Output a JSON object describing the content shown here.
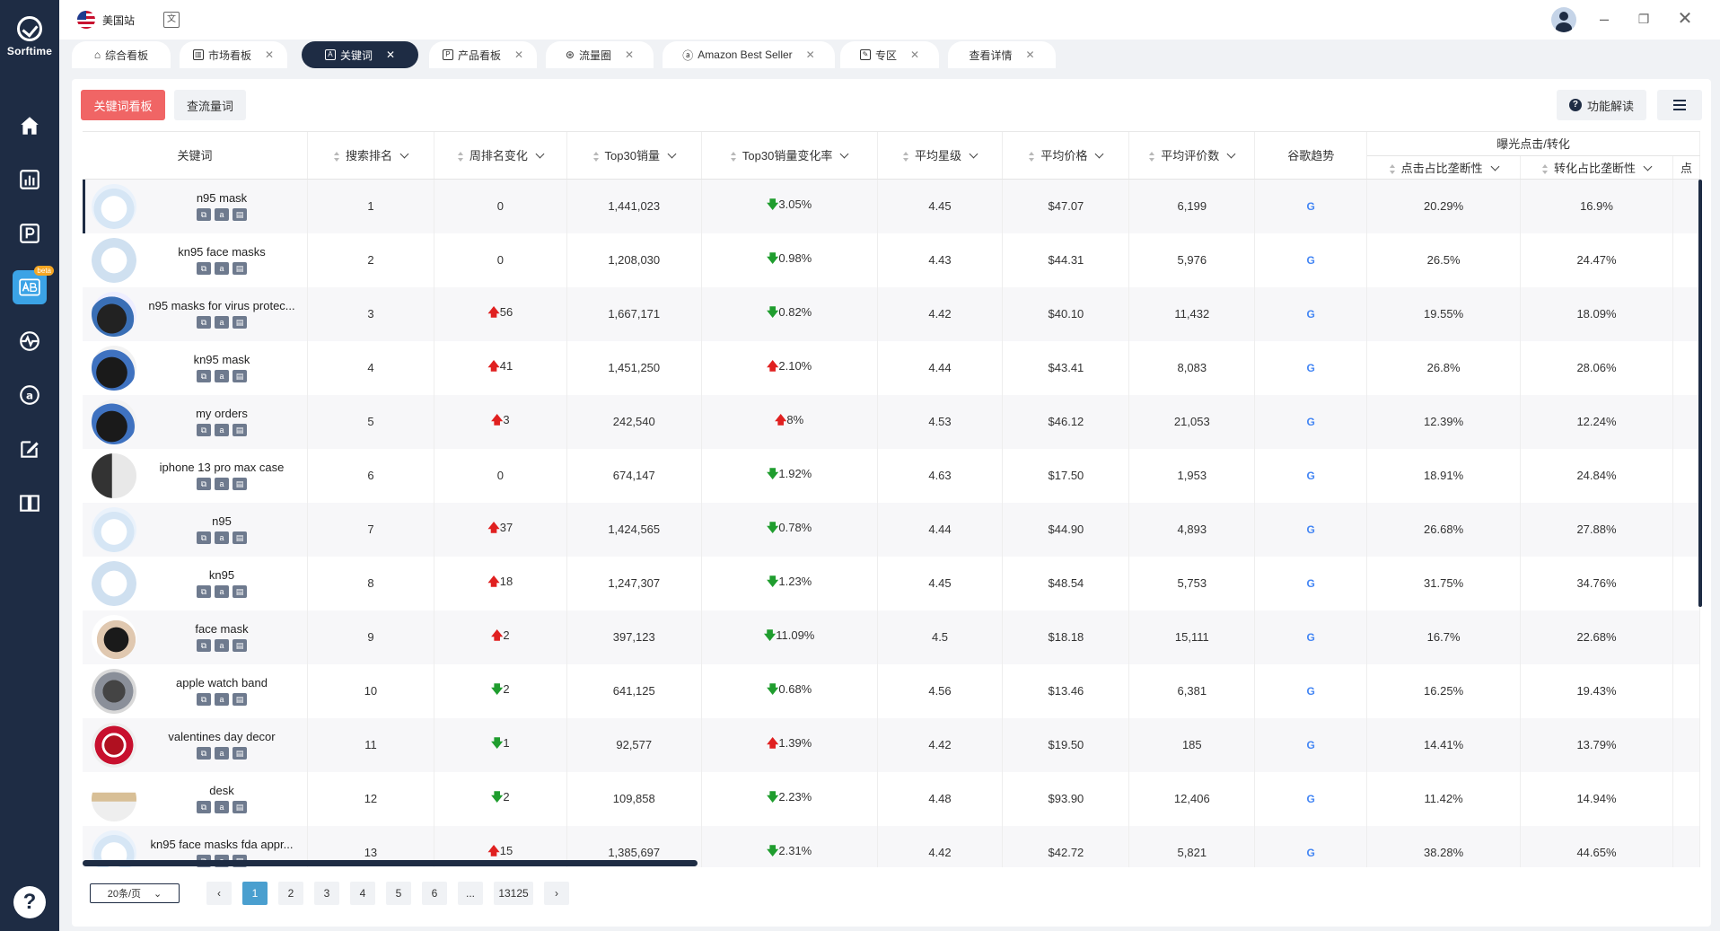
{
  "brand": {
    "name": "Sorftime",
    "beta": "beta"
  },
  "topbar": {
    "site": "美国站",
    "translate_icon": "文"
  },
  "tabs": [
    {
      "label": "综合看板",
      "icon": "home-icon",
      "closable": false
    },
    {
      "label": "市场看板",
      "icon": "chart-icon",
      "closable": true
    },
    {
      "label": "关键词",
      "icon": "keyword-icon",
      "closable": true,
      "active": true
    },
    {
      "label": "产品看板",
      "icon": "product-icon",
      "closable": true
    },
    {
      "label": "流量圈",
      "icon": "traffic-icon",
      "closable": true
    },
    {
      "label": "Amazon Best Seller",
      "icon": "amazon-icon",
      "closable": true
    },
    {
      "label": "专区",
      "icon": "edit-icon",
      "closable": true
    },
    {
      "label": "查看详情",
      "icon": "",
      "closable": true
    }
  ],
  "toolbar": {
    "btn_primary": "关键词看板",
    "btn_secondary": "查流量词",
    "btn_func": "功能解读"
  },
  "table": {
    "group_header": "曝光点击/转化",
    "columns": [
      "关键词",
      "搜索排名",
      "周排名变化",
      "Top30销量",
      "Top30销量变化率",
      "平均星级",
      "平均价格",
      "平均评价数",
      "谷歌趋势",
      "点击占比垄断性",
      "转化占比垄断性",
      "点"
    ],
    "rows": [
      {
        "kw": "n95 mask",
        "rank": "1",
        "chg": "0",
        "chg_dir": "",
        "sales": "1,441,023",
        "rate": "3.05%",
        "rate_dir": "down",
        "star": "4.45",
        "price": "$47.07",
        "reviews": "6,199",
        "click": "20.29%",
        "conv": "16.9%"
      },
      {
        "kw": "kn95 face masks",
        "rank": "2",
        "chg": "0",
        "chg_dir": "",
        "sales": "1,208,030",
        "rate": "0.98%",
        "rate_dir": "down",
        "star": "4.43",
        "price": "$44.31",
        "reviews": "5,976",
        "click": "26.5%",
        "conv": "24.47%"
      },
      {
        "kw": "n95 masks for virus protec...",
        "rank": "3",
        "chg": "56",
        "chg_dir": "up",
        "sales": "1,667,171",
        "rate": "0.82%",
        "rate_dir": "down",
        "star": "4.42",
        "price": "$40.10",
        "reviews": "11,432",
        "click": "19.55%",
        "conv": "18.09%"
      },
      {
        "kw": "kn95 mask",
        "rank": "4",
        "chg": "41",
        "chg_dir": "up",
        "sales": "1,451,250",
        "rate": "2.10%",
        "rate_dir": "up",
        "star": "4.44",
        "price": "$43.41",
        "reviews": "8,083",
        "click": "26.8%",
        "conv": "28.06%"
      },
      {
        "kw": "my orders",
        "rank": "5",
        "chg": "3",
        "chg_dir": "up",
        "sales": "242,540",
        "rate": "8%",
        "rate_dir": "up",
        "star": "4.53",
        "price": "$46.12",
        "reviews": "21,053",
        "click": "12.39%",
        "conv": "12.24%"
      },
      {
        "kw": "iphone 13 pro max case",
        "rank": "6",
        "chg": "0",
        "chg_dir": "",
        "sales": "674,147",
        "rate": "1.92%",
        "rate_dir": "down",
        "star": "4.63",
        "price": "$17.50",
        "reviews": "1,953",
        "click": "18.91%",
        "conv": "24.84%"
      },
      {
        "kw": "n95",
        "rank": "7",
        "chg": "37",
        "chg_dir": "up",
        "sales": "1,424,565",
        "rate": "0.78%",
        "rate_dir": "down",
        "star": "4.44",
        "price": "$44.90",
        "reviews": "4,893",
        "click": "26.68%",
        "conv": "27.88%"
      },
      {
        "kw": "kn95",
        "rank": "8",
        "chg": "18",
        "chg_dir": "up",
        "sales": "1,247,307",
        "rate": "1.23%",
        "rate_dir": "down",
        "star": "4.45",
        "price": "$48.54",
        "reviews": "5,753",
        "click": "31.75%",
        "conv": "34.76%"
      },
      {
        "kw": "face mask",
        "rank": "9",
        "chg": "2",
        "chg_dir": "up",
        "sales": "397,123",
        "rate": "11.09%",
        "rate_dir": "down",
        "star": "4.5",
        "price": "$18.18",
        "reviews": "15,111",
        "click": "16.7%",
        "conv": "22.68%"
      },
      {
        "kw": "apple watch band",
        "rank": "10",
        "chg": "2",
        "chg_dir": "down",
        "sales": "641,125",
        "rate": "0.68%",
        "rate_dir": "down",
        "star": "4.56",
        "price": "$13.46",
        "reviews": "6,381",
        "click": "16.25%",
        "conv": "19.43%"
      },
      {
        "kw": "valentines day decor",
        "rank": "11",
        "chg": "1",
        "chg_dir": "down",
        "sales": "92,577",
        "rate": "1.39%",
        "rate_dir": "up",
        "star": "4.42",
        "price": "$19.50",
        "reviews": "185",
        "click": "14.41%",
        "conv": "13.79%"
      },
      {
        "kw": "desk",
        "rank": "12",
        "chg": "2",
        "chg_dir": "down",
        "sales": "109,858",
        "rate": "2.23%",
        "rate_dir": "down",
        "star": "4.48",
        "price": "$93.90",
        "reviews": "12,406",
        "click": "11.42%",
        "conv": "14.94%"
      },
      {
        "kw": "kn95 face masks fda appr...",
        "rank": "13",
        "chg": "15",
        "chg_dir": "up",
        "sales": "1,385,697",
        "rate": "2.31%",
        "rate_dir": "down",
        "star": "4.42",
        "price": "$42.72",
        "reviews": "5,821",
        "click": "38.28%",
        "conv": "44.65%"
      }
    ]
  },
  "pagination": {
    "page_size": "20条/页",
    "pages": [
      "1",
      "2",
      "3",
      "4",
      "5",
      "6",
      "...",
      "13125"
    ],
    "current": "1"
  },
  "colors": {
    "rail": "#1e2c44",
    "primary_btn": "#f06565",
    "active_page": "#4a9fcf",
    "up": "#e02020",
    "down": "#1f9d2e"
  }
}
